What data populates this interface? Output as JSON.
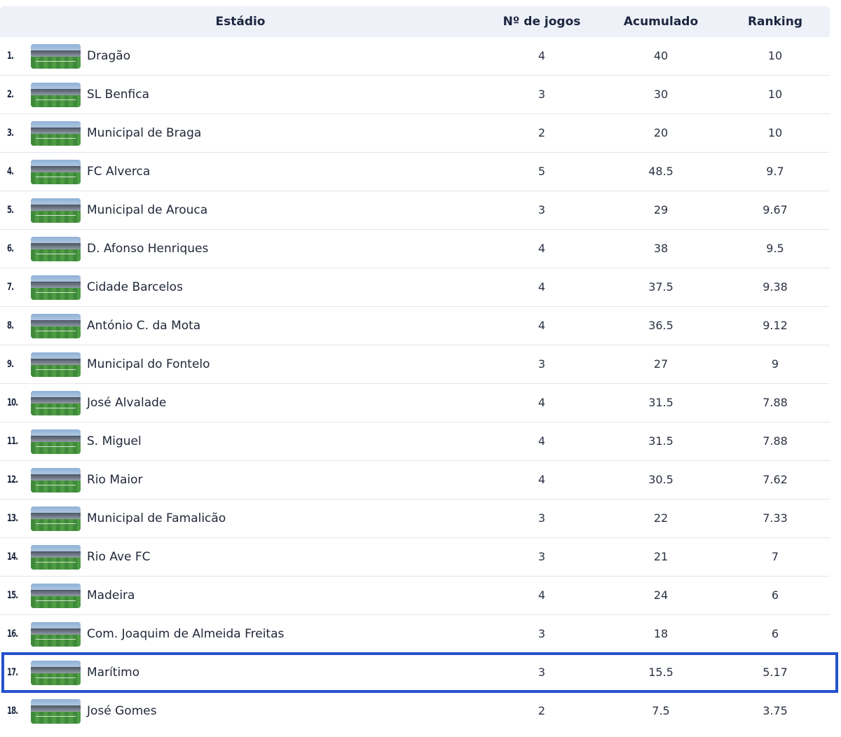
{
  "table": {
    "headers": {
      "stadium": "Estádio",
      "games": "Nº de jogos",
      "accumulated": "Acumulado",
      "ranking": "Ranking"
    },
    "highlight_color": "#2552cc",
    "highlighted_position": "17.",
    "rows": [
      {
        "pos": "1.",
        "name": "Dragão",
        "games": "4",
        "accumulated": "40",
        "ranking": "10"
      },
      {
        "pos": "2.",
        "name": "SL Benfica",
        "games": "3",
        "accumulated": "30",
        "ranking": "10"
      },
      {
        "pos": "3.",
        "name": "Municipal de Braga",
        "games": "2",
        "accumulated": "20",
        "ranking": "10"
      },
      {
        "pos": "4.",
        "name": "FC Alverca",
        "games": "5",
        "accumulated": "48.5",
        "ranking": "9.7"
      },
      {
        "pos": "5.",
        "name": "Municipal de Arouca",
        "games": "3",
        "accumulated": "29",
        "ranking": "9.67"
      },
      {
        "pos": "6.",
        "name": "D. Afonso Henriques",
        "games": "4",
        "accumulated": "38",
        "ranking": "9.5"
      },
      {
        "pos": "7.",
        "name": "Cidade Barcelos",
        "games": "4",
        "accumulated": "37.5",
        "ranking": "9.38"
      },
      {
        "pos": "8.",
        "name": "António C. da Mota",
        "games": "4",
        "accumulated": "36.5",
        "ranking": "9.12"
      },
      {
        "pos": "9.",
        "name": "Municipal do Fontelo",
        "games": "3",
        "accumulated": "27",
        "ranking": "9"
      },
      {
        "pos": "10.",
        "name": "José Alvalade",
        "games": "4",
        "accumulated": "31.5",
        "ranking": "7.88"
      },
      {
        "pos": "11.",
        "name": "S. Miguel",
        "games": "4",
        "accumulated": "31.5",
        "ranking": "7.88"
      },
      {
        "pos": "12.",
        "name": "Rio Maior",
        "games": "4",
        "accumulated": "30.5",
        "ranking": "7.62"
      },
      {
        "pos": "13.",
        "name": "Municipal de Famalicão",
        "games": "3",
        "accumulated": "22",
        "ranking": "7.33"
      },
      {
        "pos": "14.",
        "name": "Rio Ave FC",
        "games": "3",
        "accumulated": "21",
        "ranking": "7"
      },
      {
        "pos": "15.",
        "name": "Madeira",
        "games": "4",
        "accumulated": "24",
        "ranking": "6"
      },
      {
        "pos": "16.",
        "name": "Com. Joaquim de Almeida Freitas",
        "games": "3",
        "accumulated": "18",
        "ranking": "6"
      },
      {
        "pos": "17.",
        "name": "Marítimo",
        "games": "3",
        "accumulated": "15.5",
        "ranking": "5.17"
      },
      {
        "pos": "18.",
        "name": "José Gomes",
        "games": "2",
        "accumulated": "7.5",
        "ranking": "3.75"
      }
    ]
  }
}
